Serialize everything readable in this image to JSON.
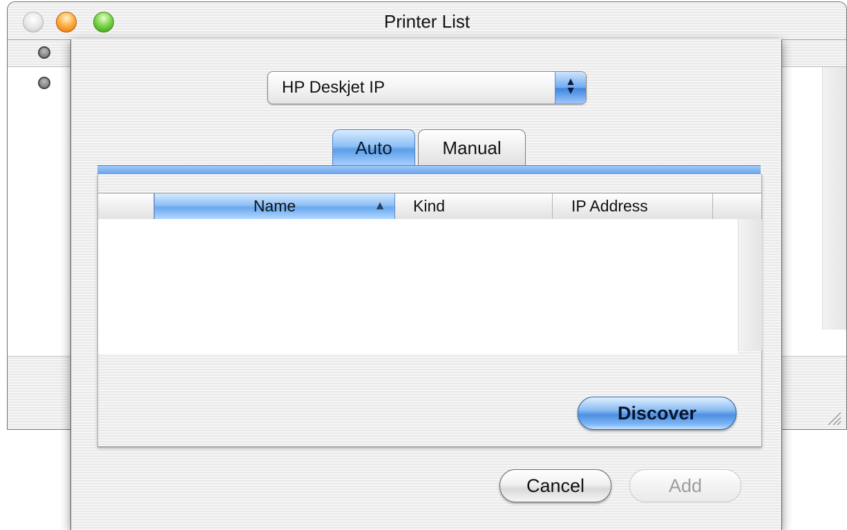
{
  "window": {
    "title": "Printer List"
  },
  "sheet": {
    "connection_popup": {
      "selected": "HP Deskjet IP"
    },
    "tabs": [
      {
        "label": "Auto",
        "active": true
      },
      {
        "label": "Manual",
        "active": false
      }
    ],
    "table": {
      "columns": [
        "Name",
        "Kind",
        "IP Address"
      ],
      "sorted_column": "Name",
      "sort_direction": "ascending",
      "rows": []
    },
    "buttons": {
      "discover": "Discover",
      "cancel": "Cancel",
      "add": "Add",
      "add_enabled": false
    }
  },
  "colors": {
    "accent_blue": "#6aa9ef",
    "close_light": "#d9d9d9",
    "minimize_light": "#ffb24a",
    "zoom_light": "#7fd54c"
  },
  "icons": {
    "popup_arrows": "up-down-arrows-icon",
    "sort": "sort-ascending-icon",
    "grow": "resize-grip-icon"
  }
}
